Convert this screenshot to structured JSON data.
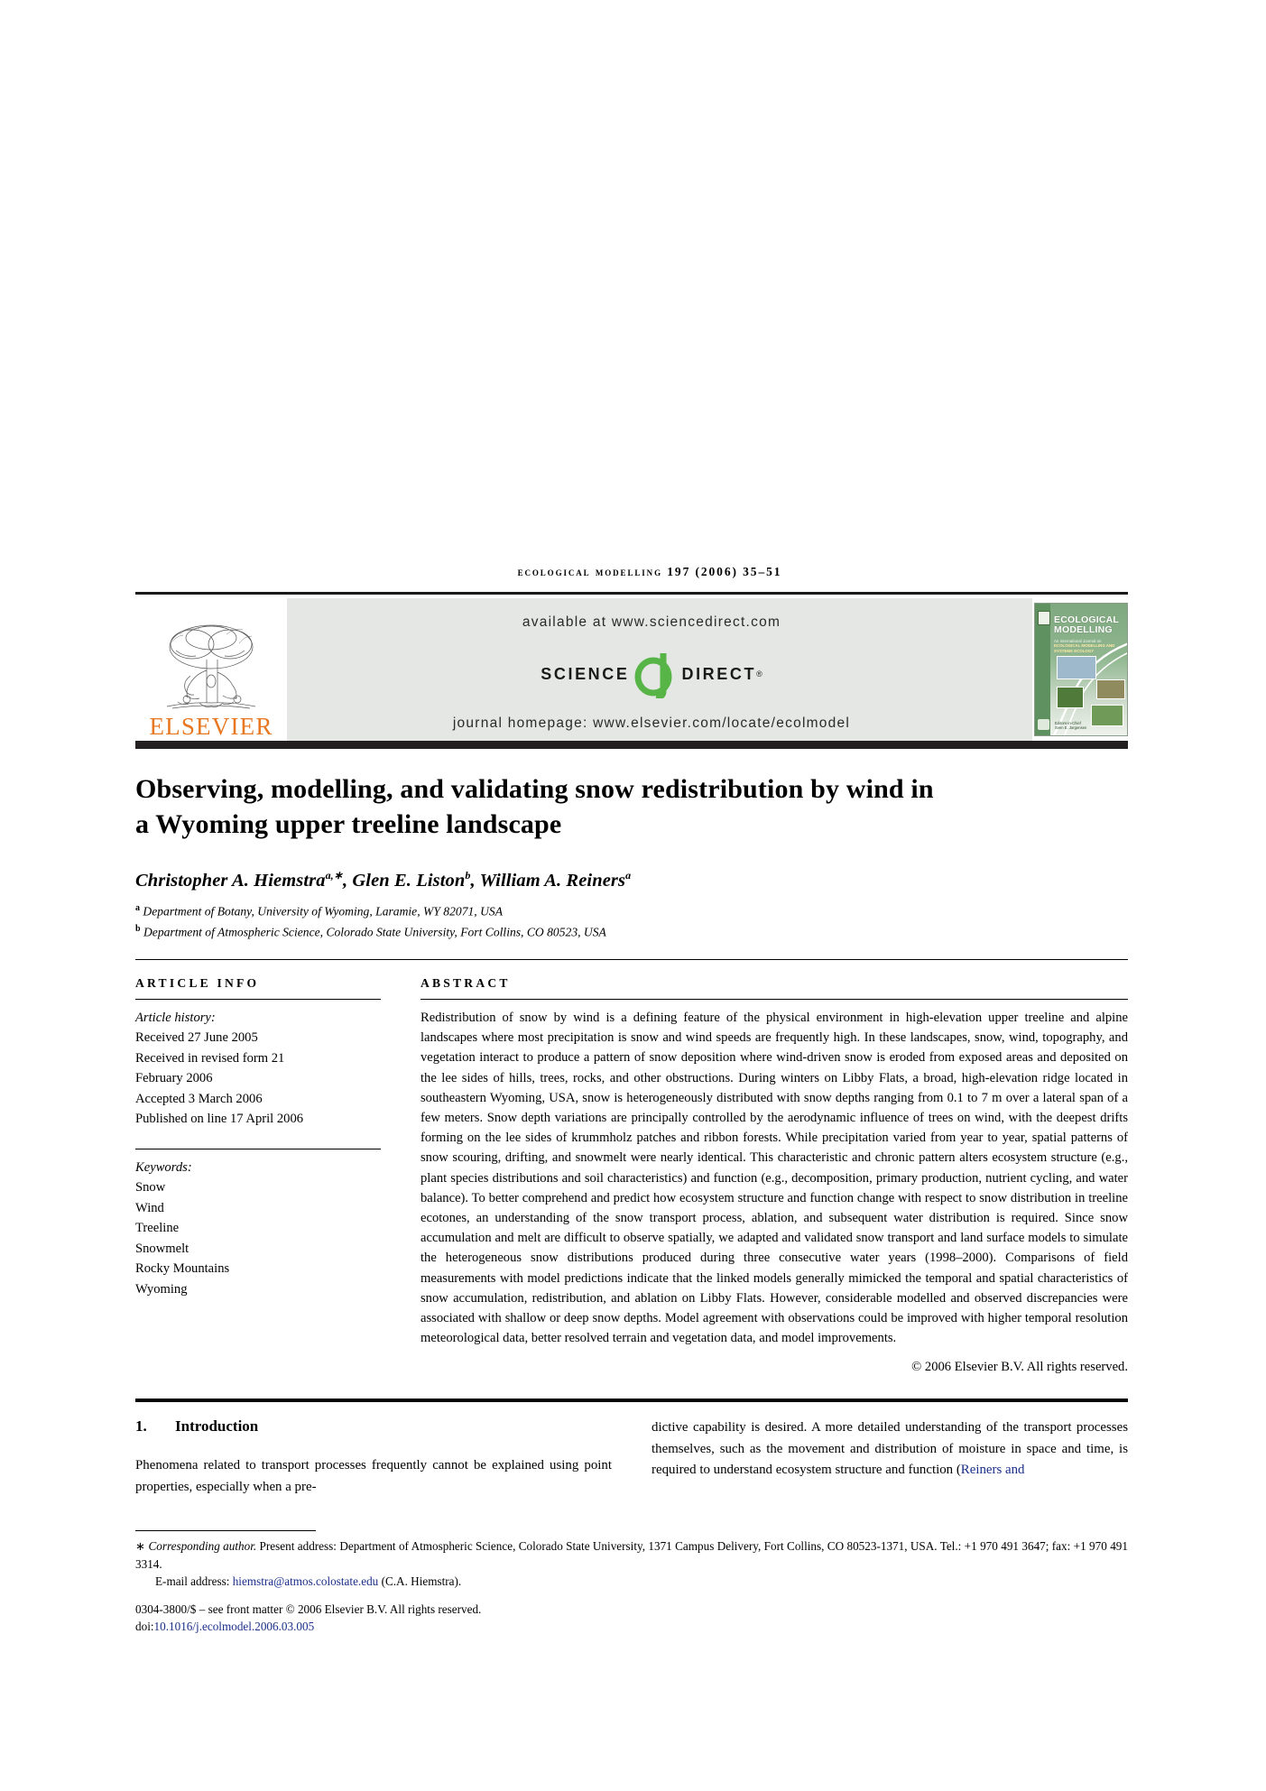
{
  "running_head": {
    "journal": "ECOLOGICAL MODELLING",
    "volume_year_pages": "197 (2006) 35–51"
  },
  "masthead": {
    "available_at": "available at www.sciencedirect.com",
    "science_word": "SCIENCE",
    "direct_word": "DIRECT",
    "registered_mark": "®",
    "homepage": "journal homepage: www.elsevier.com/locate/ecolmodel",
    "publisher": "ELSEVIER",
    "cover": {
      "title_line1": "ECOLOGICAL",
      "title_line2": "MODELLING",
      "subtitle": "An International Journal on",
      "subtitle_bold": "ECOLOGICAL MODELLING AND SYSTEMS ECOLOGY",
      "editor_note": "Editors-in-Chief",
      "editor_name": "Sven E. Jorgensen"
    },
    "colors": {
      "elsevier_orange": "#E87722",
      "sciencedirect_green": "#57B447",
      "banner_grey": "#E4E7E4",
      "cover_green": "#5F9160"
    }
  },
  "article": {
    "title": "Observing, modelling, and validating snow redistribution by wind in a Wyoming upper treeline landscape",
    "authors_html": "Christopher A. Hiemstra",
    "authors": [
      {
        "name": "Christopher A. Hiemstra",
        "marks": "a,∗"
      },
      {
        "name": "Glen E. Liston",
        "marks": "b"
      },
      {
        "name": "William A. Reiners",
        "marks": "a"
      }
    ],
    "affiliations": [
      {
        "mark": "a",
        "text": "Department of Botany, University of Wyoming, Laramie, WY 82071, USA"
      },
      {
        "mark": "b",
        "text": "Department of Atmospheric Science, Colorado State University, Fort Collins, CO 80523, USA"
      }
    ]
  },
  "article_info": {
    "heading": "ARTICLE INFO",
    "history_label": "Article history:",
    "history": [
      "Received 27 June 2005",
      "Received in revised form 21",
      "February 2006",
      "Accepted 3 March 2006",
      "Published on line 17 April 2006"
    ],
    "keywords_label": "Keywords:",
    "keywords": [
      "Snow",
      "Wind",
      "Treeline",
      "Snowmelt",
      "Rocky Mountains",
      "Wyoming"
    ]
  },
  "abstract": {
    "heading": "ABSTRACT",
    "text": "Redistribution of snow by wind is a defining feature of the physical environment in high-elevation upper treeline and alpine landscapes where most precipitation is snow and wind speeds are frequently high. In these landscapes, snow, wind, topography, and vegetation interact to produce a pattern of snow deposition where wind-driven snow is eroded from exposed areas and deposited on the lee sides of hills, trees, rocks, and other obstructions. During winters on Libby Flats, a broad, high-elevation ridge located in southeastern Wyoming, USA, snow is heterogeneously distributed with snow depths ranging from 0.1 to 7 m over a lateral span of a few meters. Snow depth variations are principally controlled by the aerodynamic influence of trees on wind, with the deepest drifts forming on the lee sides of krummholz patches and ribbon forests. While precipitation varied from year to year, spatial patterns of snow scouring, drifting, and snowmelt were nearly identical. This characteristic and chronic pattern alters ecosystem structure (e.g., plant species distributions and soil characteristics) and function (e.g., decomposition, primary production, nutrient cycling, and water balance). To better comprehend and predict how ecosystem structure and function change with respect to snow distribution in treeline ecotones, an understanding of the snow transport process, ablation, and subsequent water distribution is required. Since snow accumulation and melt are difficult to observe spatially, we adapted and validated snow transport and land surface models to simulate the heterogeneous snow distributions produced during three consecutive water years (1998–2000). Comparisons of field measurements with model predictions indicate that the linked models generally mimicked the temporal and spatial characteristics of snow accumulation, redistribution, and ablation on Libby Flats. However, considerable modelled and observed discrepancies were associated with shallow or deep snow depths. Model agreement with observations could be improved with higher temporal resolution meteorological data, better resolved terrain and vegetation data, and model improvements.",
    "copyright": "© 2006 Elsevier B.V. All rights reserved."
  },
  "introduction": {
    "number": "1.",
    "heading": "Introduction",
    "column_left": "Phenomena related to transport processes frequently cannot be explained using point properties, especially when a pre-",
    "column_right_pre": "dictive capability is desired. A more detailed understanding of the transport processes themselves, such as the movement and distribution of moisture in space and time, is required to understand ecosystem structure and function (",
    "column_right_cite": "Reiners and"
  },
  "footnotes": {
    "corresponding_mark": "∗",
    "corresponding_label": "Corresponding author.",
    "corresponding_text": " Present address: Department of Atmospheric Science, Colorado State University, 1371 Campus Delivery, Fort Collins, CO 80523-1371, USA. Tel.: +1 970 491 3647; fax: +1 970 491 3314.",
    "email_label": "E-mail address:",
    "email": "hiemstra@atmos.colostate.edu",
    "email_attrib": " (C.A. Hiemstra).",
    "issn_line": "0304-3800/$ – see front matter © 2006 Elsevier B.V. All rights reserved.",
    "doi_label": "doi:",
    "doi": "10.1016/j.ecolmodel.2006.03.005"
  }
}
